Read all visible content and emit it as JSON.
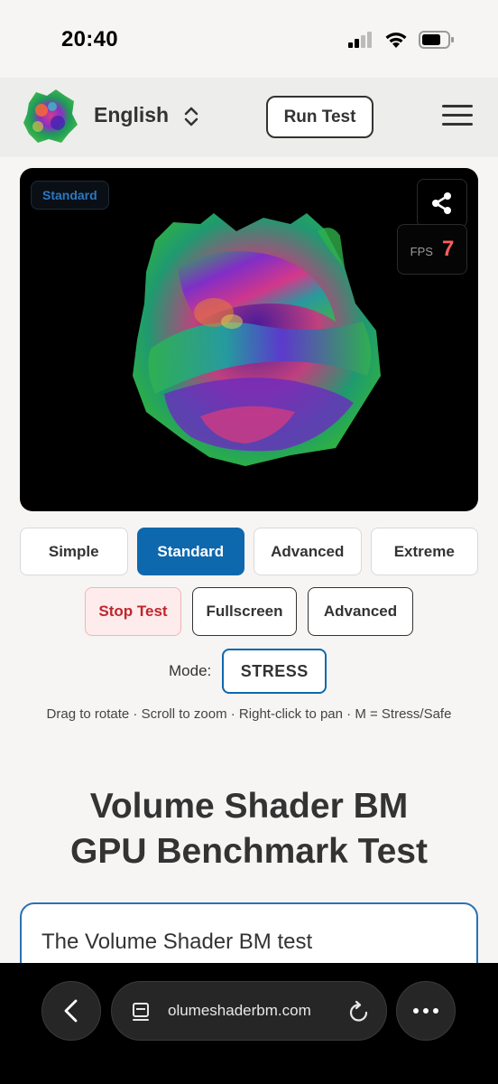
{
  "status_bar": {
    "time": "20:40"
  },
  "header": {
    "language": "English",
    "run_test_label": "Run Test"
  },
  "viewer": {
    "mode_badge": "Standard",
    "fps_label": "FPS",
    "fps_value": "7"
  },
  "quality_buttons": [
    {
      "label": "Simple",
      "active": false
    },
    {
      "label": "Standard",
      "active": true
    },
    {
      "label": "Advanced",
      "active": false
    },
    {
      "label": "Extreme",
      "active": false
    }
  ],
  "actions": {
    "stop_label": "Stop Test",
    "fullscreen_label": "Fullscreen",
    "advanced_label": "Advanced"
  },
  "mode": {
    "label": "Mode:",
    "value": "STRESS"
  },
  "hint": "Drag to rotate · Scroll to zoom · Right-click to pan · M = Stress/Safe",
  "page_title": {
    "line1": "Volume Shader BM",
    "line2": "GPU Benchmark Test"
  },
  "card": {
    "text": "The Volume Shader BM test"
  },
  "browser": {
    "url": "olumeshaderbm.com"
  },
  "colors": {
    "accent": "#0e68ad",
    "stop": "#c0262d",
    "fps": "#ff5d5d"
  },
  "icons": [
    "signal-icon",
    "wifi-icon",
    "battery-icon",
    "chevron-updown-icon",
    "hamburger-menu-icon",
    "share-icon",
    "back-arrow-icon",
    "tabs-icon",
    "reload-icon",
    "more-icon"
  ]
}
